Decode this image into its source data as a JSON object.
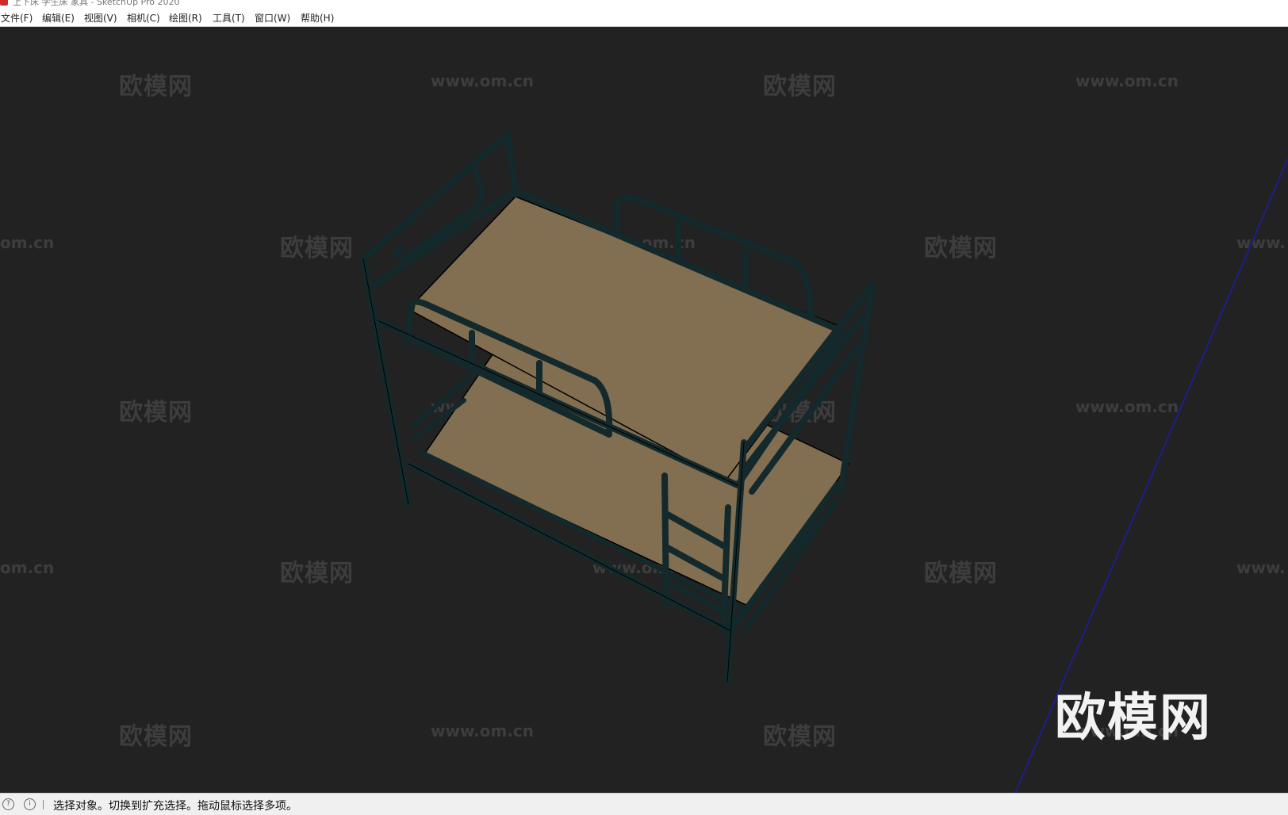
{
  "window": {
    "title": "上下床 学生床 家具 - SketchUp Pro 2020",
    "icon": "sketchup-app-icon"
  },
  "menu": [
    {
      "label": "文件(F)"
    },
    {
      "label": "编辑(E)"
    },
    {
      "label": "视图(V)"
    },
    {
      "label": "相机(C)"
    },
    {
      "label": "绘图(R)"
    },
    {
      "label": "工具(T)"
    },
    {
      "label": "窗口(W)"
    },
    {
      "label": "帮助(H)"
    }
  ],
  "watermark": {
    "logo_text": "欧模网",
    "url_text": "www.om.cn",
    "url_partial_left": "om.cn",
    "url_partial_right": "www.",
    "brand_logo": "欧模网"
  },
  "colors": {
    "viewport_bg": "#222222",
    "frame": "#13292b",
    "frame_edge": "#000000",
    "mattress": "#826e51",
    "axis_blue": "#1e1e8c"
  },
  "status": {
    "text": "选择对象。切换到扩充选择。拖动鼠标选择多项。",
    "icons": [
      "geo-location-icon",
      "info-icon"
    ]
  }
}
